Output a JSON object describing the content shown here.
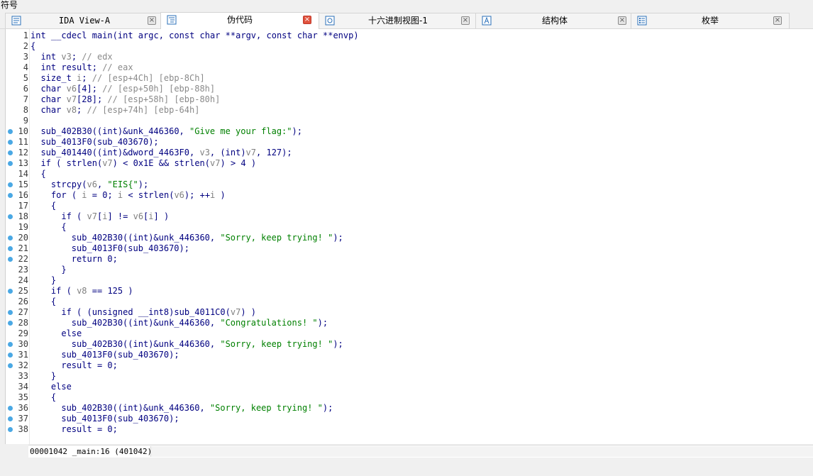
{
  "window": {
    "title": "符号"
  },
  "tabs": [
    {
      "label": "IDA View-A",
      "icon": "graph-view-icon",
      "active": false
    },
    {
      "label": "伪代码",
      "icon": "pseudocode-icon",
      "active": true
    },
    {
      "label": "十六进制视图-1",
      "icon": "hex-view-icon",
      "active": false
    },
    {
      "label": "结构体",
      "icon": "structures-icon",
      "active": false
    },
    {
      "label": "枚举",
      "icon": "enums-icon",
      "active": false
    }
  ],
  "code": {
    "lines": [
      {
        "n": "1",
        "text": "int __cdecl main(int argc, const char **argv, const char **envp)",
        "dot": false
      },
      {
        "n": "2",
        "text": "{",
        "dot": false
      },
      {
        "n": "3",
        "text": "  int v3; // edx",
        "dot": false
      },
      {
        "n": "4",
        "text": "  int result; // eax",
        "dot": false
      },
      {
        "n": "5",
        "text": "  size_t i; // [esp+4Ch] [ebp-8Ch]",
        "dot": false
      },
      {
        "n": "6",
        "text": "  char v6[4]; // [esp+50h] [ebp-88h]",
        "dot": false
      },
      {
        "n": "7",
        "text": "  char v7[28]; // [esp+58h] [ebp-80h]",
        "dot": false
      },
      {
        "n": "8",
        "text": "  char v8; // [esp+74h] [ebp-64h]",
        "dot": false
      },
      {
        "n": "9",
        "text": "",
        "dot": false
      },
      {
        "n": "10",
        "text": "  sub_402B30((int)&unk_446360, \"Give me your flag:\");",
        "dot": true
      },
      {
        "n": "11",
        "text": "  sub_4013F0(sub_403670);",
        "dot": true
      },
      {
        "n": "12",
        "text": "  sub_401440((int)&dword_4463F0, v3, (int)v7, 127);",
        "dot": true
      },
      {
        "n": "13",
        "text": "  if ( strlen(v7) < 0x1E && strlen(v7) > 4 )",
        "dot": true
      },
      {
        "n": "14",
        "text": "  {",
        "dot": false
      },
      {
        "n": "15",
        "text": "    strcpy(v6, \"EIS{\");",
        "dot": true
      },
      {
        "n": "16",
        "text": "    for ( i = 0; i < strlen(v6); ++i )",
        "dot": true
      },
      {
        "n": "17",
        "text": "    {",
        "dot": false
      },
      {
        "n": "18",
        "text": "      if ( v7[i] != v6[i] )",
        "dot": true
      },
      {
        "n": "19",
        "text": "      {",
        "dot": false
      },
      {
        "n": "20",
        "text": "        sub_402B30((int)&unk_446360, \"Sorry, keep trying! \");",
        "dot": true
      },
      {
        "n": "21",
        "text": "        sub_4013F0(sub_403670);",
        "dot": true
      },
      {
        "n": "22",
        "text": "        return 0;",
        "dot": true
      },
      {
        "n": "23",
        "text": "      }",
        "dot": false
      },
      {
        "n": "24",
        "text": "    }",
        "dot": false
      },
      {
        "n": "25",
        "text": "    if ( v8 == 125 )",
        "dot": true
      },
      {
        "n": "26",
        "text": "    {",
        "dot": false
      },
      {
        "n": "27",
        "text": "      if ( (unsigned __int8)sub_4011C0(v7) )",
        "dot": true
      },
      {
        "n": "28",
        "text": "        sub_402B30((int)&unk_446360, \"Congratulations! \");",
        "dot": true
      },
      {
        "n": "29",
        "text": "      else",
        "dot": false
      },
      {
        "n": "30",
        "text": "        sub_402B30((int)&unk_446360, \"Sorry, keep trying! \");",
        "dot": true
      },
      {
        "n": "31",
        "text": "      sub_4013F0(sub_403670);",
        "dot": true
      },
      {
        "n": "32",
        "text": "      result = 0;",
        "dot": true
      },
      {
        "n": "33",
        "text": "    }",
        "dot": false
      },
      {
        "n": "34",
        "text": "    else",
        "dot": false
      },
      {
        "n": "35",
        "text": "    {",
        "dot": false
      },
      {
        "n": "36",
        "text": "      sub_402B30((int)&unk_446360, \"Sorry, keep trying! \");",
        "dot": true
      },
      {
        "n": "37",
        "text": "      sub_4013F0(sub_403670);",
        "dot": true
      },
      {
        "n": "38",
        "text": "      result = 0;",
        "dot": true
      }
    ]
  },
  "status": {
    "text": "00001042 _main:16 (401042)"
  },
  "colors": {
    "keyword": "#000080",
    "string": "#008000",
    "comment": "#8a8a8a",
    "variable": "#808080",
    "identifier": "#000080",
    "breakpoint_dot": "#4aa8e4",
    "active_tab_close": "#e0523d"
  }
}
